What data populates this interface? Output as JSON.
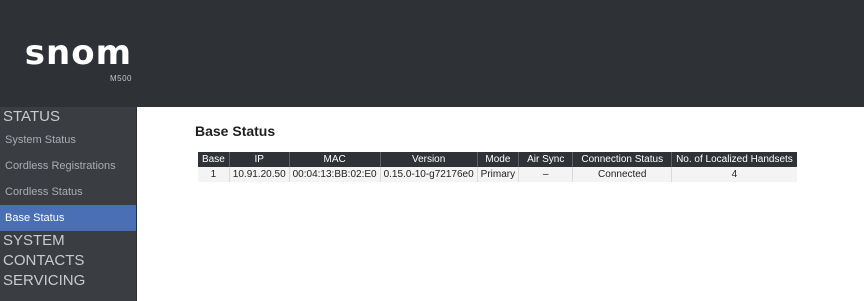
{
  "brand": {
    "name": "snom",
    "model": "M500"
  },
  "sidebar": {
    "sections": [
      {
        "label": "STATUS"
      },
      {
        "label": "SYSTEM"
      },
      {
        "label": "CONTACTS"
      },
      {
        "label": "SERVICING"
      }
    ],
    "status_items": [
      {
        "label": "System Status"
      },
      {
        "label": "Cordless Registrations"
      },
      {
        "label": "Cordless Status"
      },
      {
        "label": "Base Status"
      }
    ],
    "active_item": "Base Status"
  },
  "main": {
    "title": "Base Status",
    "table": {
      "columns": [
        "Base",
        "IP",
        "MAC",
        "Version",
        "Mode",
        "Air Sync",
        "Connection Status",
        "No. of Localized Handsets"
      ],
      "rows": [
        [
          "1",
          "10.91.20.50",
          "00:04:13:BB:02:E0",
          "0.15.0-10-g72176e0",
          "Primary",
          "–",
          "Connected",
          "4"
        ]
      ]
    }
  },
  "colors": {
    "header_bg": "#2e3237",
    "sidebar_bg": "#3a3d42",
    "active_item_bg": "#4a6fb5",
    "table_header_bg": "#2f3236"
  }
}
